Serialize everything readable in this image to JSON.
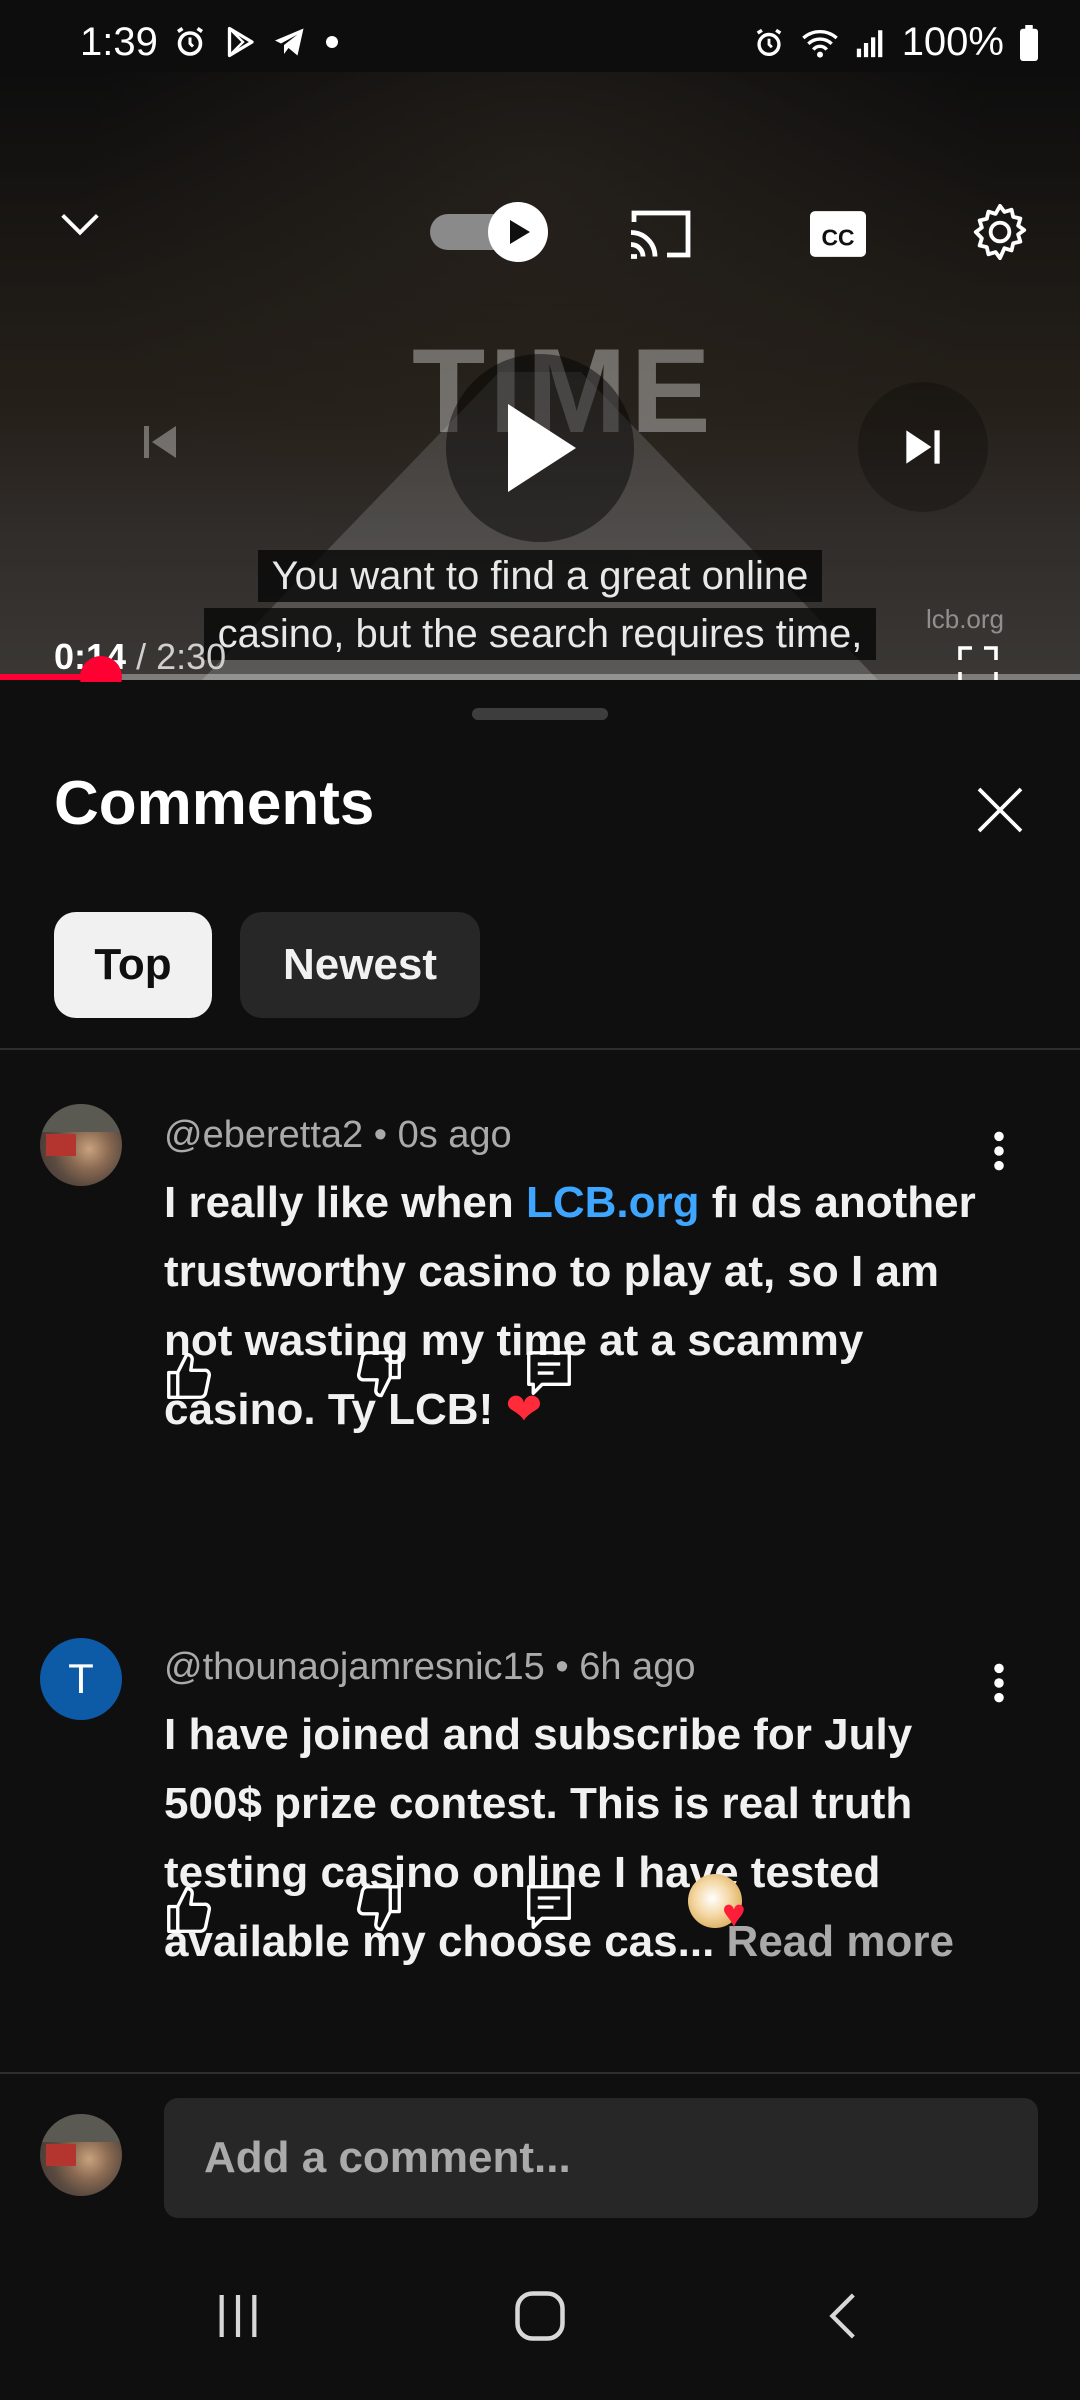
{
  "status_bar": {
    "time": "1:39",
    "battery_text": "100%",
    "left_icons": [
      "alarm-icon",
      "play-store-icon",
      "telegram-icon",
      "dot-icon"
    ],
    "right_icons": [
      "alarm-icon",
      "wifi-icon",
      "signal-icon",
      "battery-icon"
    ]
  },
  "player": {
    "caption_line_1": "You want to find a great online",
    "caption_line_2": "casino, but the search requires time,",
    "current_time": "0:14",
    "separator": " / ",
    "duration": "2:30",
    "progress_fraction": 0.0933,
    "watermark_text": "TIME",
    "corner_mark": "lcb.org",
    "controls": [
      "chevron-down-icon",
      "autoplay-toggle",
      "cast-icon",
      "cc-icon",
      "gear-icon",
      "previous-icon",
      "play-icon",
      "next-icon",
      "fullscreen-icon"
    ],
    "accent_color": "#ff0033"
  },
  "comments_panel": {
    "title": "Comments",
    "filters": [
      {
        "label": "Top",
        "selected": true
      },
      {
        "label": "Newest",
        "selected": false
      }
    ],
    "comments": [
      {
        "author": "@eberetta2",
        "time_ago": "0s ago",
        "text_before": "I really like when ",
        "link_text": "LCB.org",
        "text_after": " fı ds another trustworthy casino to play at, so I am not wasting my time at a scammy casino. Ty LCB! ",
        "emoji": "❤",
        "avatar": "photo"
      },
      {
        "author": "@thounaojamresnic15",
        "time_ago": "6h ago",
        "text": "I have joined and subscribe for July 500$ prize contest. This is real truth testing casino online I have tested available my  choose cas...",
        "read_more": " Read more",
        "avatar_letter": "T",
        "avatar_color": "#0d5aa7",
        "creator_hearted": true
      }
    ],
    "meta_separator": " • ",
    "add_comment_placeholder": "Add a comment..."
  },
  "nav_bar": {
    "buttons": [
      "recents-icon",
      "home-icon",
      "back-icon"
    ]
  }
}
